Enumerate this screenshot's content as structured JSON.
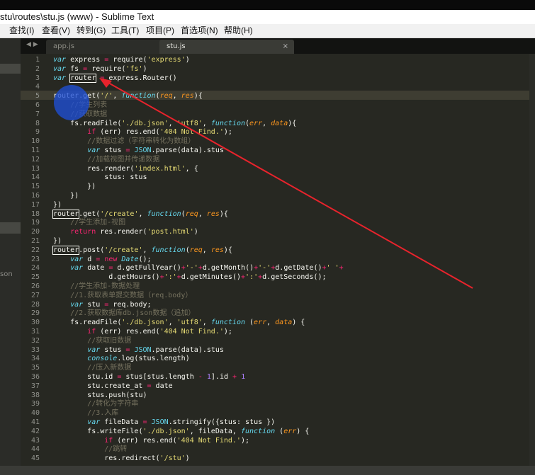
{
  "window": {
    "title": "stu\\routes\\stu.js (www) - Sublime Text"
  },
  "menu": [
    {
      "label": "查找(I)"
    },
    {
      "label": "查看(V)"
    },
    {
      "label": "转到(G)"
    },
    {
      "label": "工具(T)"
    },
    {
      "label": "项目(P)"
    },
    {
      "label": "首选项(N)"
    },
    {
      "label": "帮助(H)"
    }
  ],
  "sidebar": {
    "partial_label": "son"
  },
  "tabs": [
    {
      "label": "app.js",
      "close": "×",
      "active": false
    },
    {
      "label": "stu.js",
      "close": "×",
      "active": true
    }
  ],
  "tab_nav": "◀ ▶",
  "colors": {
    "keyword": "#66d9ef",
    "keyword_italic": "#66d9ef",
    "control": "#f92672",
    "string": "#e6db74",
    "comment": "#75715e",
    "param": "#fd971f",
    "func": "#a6e22e",
    "number": "#ae81ff",
    "plain": "#f8f8f2",
    "annotation": "#e8232c",
    "highlight_circle": "#1f4fd6"
  },
  "code_lines": [
    {
      "n": "1",
      "t": "var express = require('express')"
    },
    {
      "n": "2",
      "t": "var fs = require('fs')"
    },
    {
      "n": "3",
      "t": "var router = express.Router()"
    },
    {
      "n": "4",
      "t": ""
    },
    {
      "n": "5",
      "t": "router.get('/', function(req, res){"
    },
    {
      "n": "6",
      "t": "    //学生列表"
    },
    {
      "n": "7",
      "t": "    //获取数据"
    },
    {
      "n": "8",
      "t": "    fs.readFile('./db.json', 'utf8', function(err, data){"
    },
    {
      "n": "9",
      "t": "        if (err) res.end('404 Not Find.');"
    },
    {
      "n": "10",
      "t": "        //数据过滤（字符串转化为数组）"
    },
    {
      "n": "11",
      "t": "        var stus = JSON.parse(data).stus"
    },
    {
      "n": "12",
      "t": "        //加载视图并传递数据"
    },
    {
      "n": "13",
      "t": "        res.render('index.html', {"
    },
    {
      "n": "14",
      "t": "            stus: stus"
    },
    {
      "n": "15",
      "t": "        })"
    },
    {
      "n": "16",
      "t": "    })"
    },
    {
      "n": "17",
      "t": "})"
    },
    {
      "n": "18",
      "t": "router.get('/create', function(req, res){"
    },
    {
      "n": "19",
      "t": "    //学生添加-视图"
    },
    {
      "n": "20",
      "t": "    return res.render('post.html')"
    },
    {
      "n": "21",
      "t": "})"
    },
    {
      "n": "22",
      "t": "router.post('/create', function(req, res){"
    },
    {
      "n": "23",
      "t": "    var d = new Date();"
    },
    {
      "n": "24",
      "t": "    var date = d.getFullYear()+'-'+d.getMonth()+'-'+d.getDate()+' '+"
    },
    {
      "n": "25",
      "t": "             d.getHours()+':'+d.getMinutes()+':'+d.getSeconds();"
    },
    {
      "n": "26",
      "t": "    //学生添加-数据处理"
    },
    {
      "n": "27",
      "t": "    //1.获取表单提交数据（req.body）"
    },
    {
      "n": "28",
      "t": "    var stu = req.body;"
    },
    {
      "n": "29",
      "t": "    //2.获取数据库db.json数据（追加）"
    },
    {
      "n": "30",
      "t": "    fs.readFile('./db.json', 'utf8', function (err, data) {"
    },
    {
      "n": "31",
      "t": "        if (err) res.end('404 Not Find.');"
    },
    {
      "n": "32",
      "t": "        //获取旧数据"
    },
    {
      "n": "33",
      "t": "        var stus = JSON.parse(data).stus"
    },
    {
      "n": "34",
      "t": "        console.log(stus.length)"
    },
    {
      "n": "35",
      "t": "        //压入新数据"
    },
    {
      "n": "36",
      "t": "        stu.id = stus[stus.length - 1].id + 1"
    },
    {
      "n": "37",
      "t": "        stu.create_at = date"
    },
    {
      "n": "38",
      "t": "        stus.push(stu)"
    },
    {
      "n": "39",
      "t": "        //转化为字符串"
    },
    {
      "n": "40",
      "t": "        //3.入库"
    },
    {
      "n": "41",
      "t": "        var fileData = JSON.stringify({stus: stus })"
    },
    {
      "n": "42",
      "t": "        fs.writeFile('./db.json', fileData, function (err) {"
    },
    {
      "n": "43",
      "t": "            if (err) res.end('404 Not Find.');"
    },
    {
      "n": "44",
      "t": "            //跳转"
    },
    {
      "n": "45",
      "t": "            res.redirect('/stu')"
    }
  ]
}
